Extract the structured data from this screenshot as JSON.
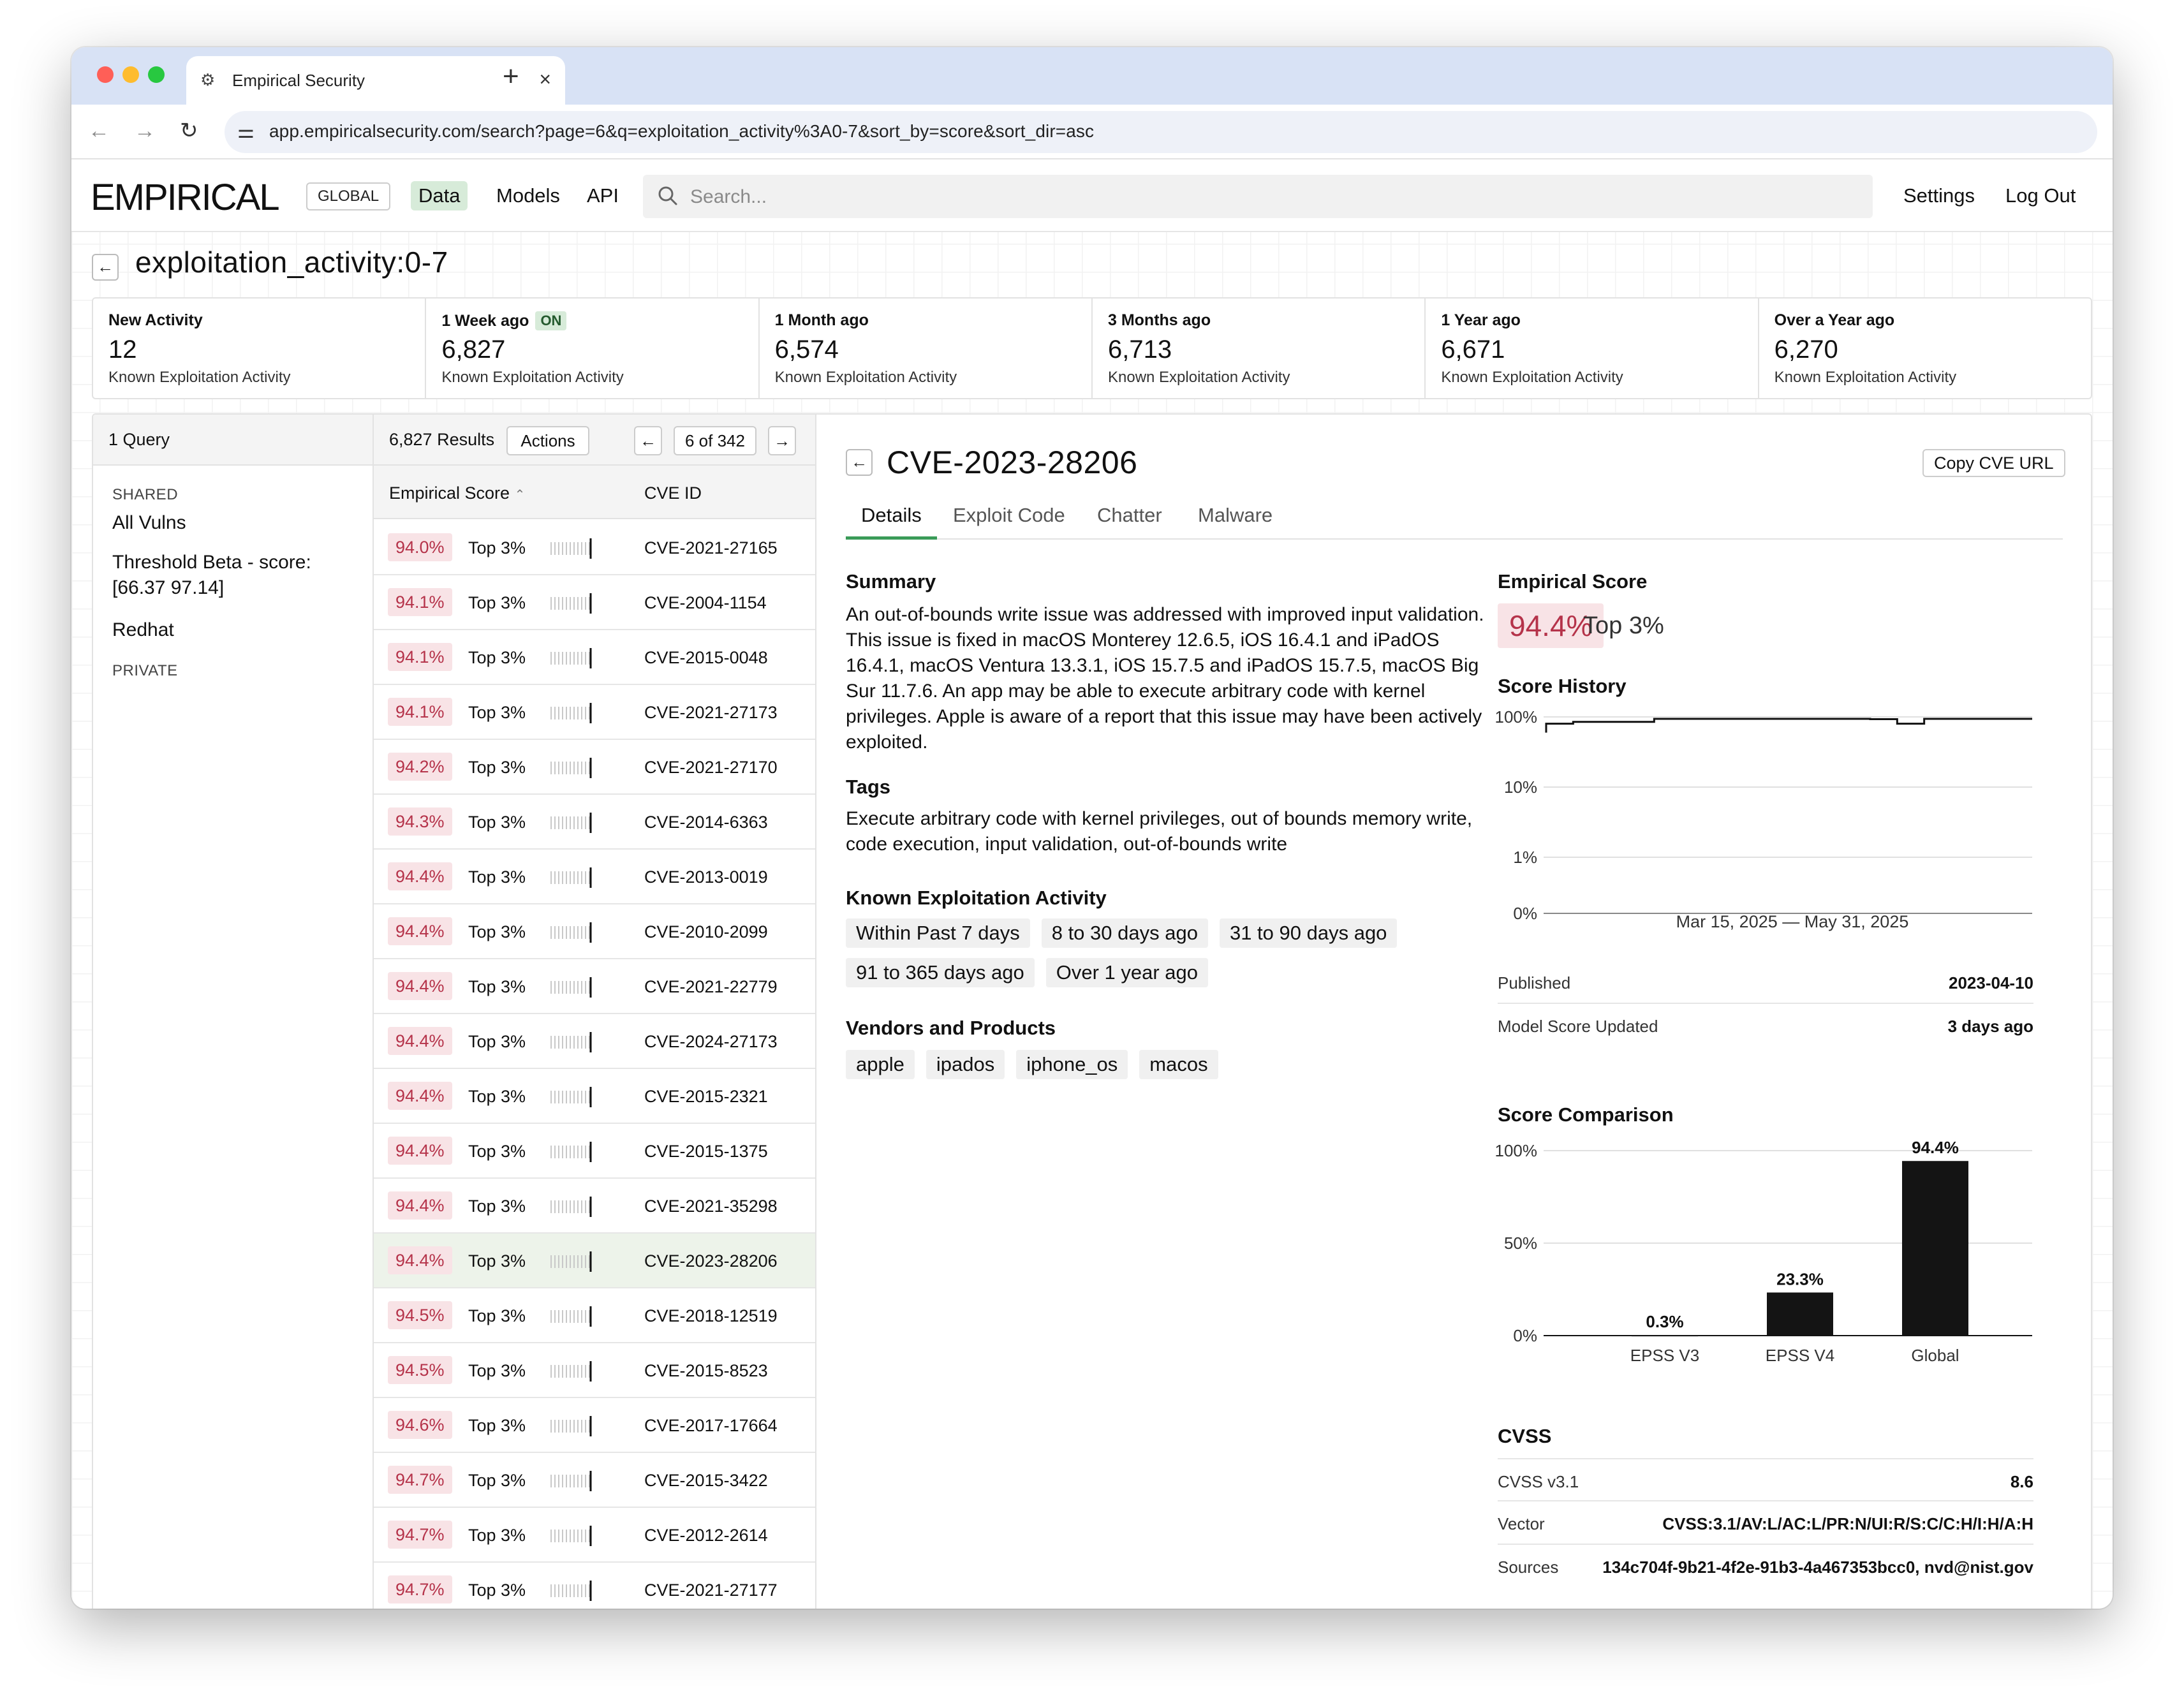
{
  "browser": {
    "tab_title": "Empirical Security",
    "url": "app.empiricalsecurity.com/search?page=6&q=exploitation_activity%3A0-7&sort_by=score&sort_dir=asc"
  },
  "nav": {
    "logo": "EMPIRICAL",
    "scope": "GLOBAL",
    "links": [
      "Data",
      "Models",
      "API"
    ],
    "active_link": "Data",
    "search_placeholder": "Search...",
    "settings": "Settings",
    "logout": "Log Out"
  },
  "page_title": "exploitation_activity:0-7",
  "stats": [
    {
      "label": "New Activity",
      "value": "12",
      "sub": "Known Exploitation Activity"
    },
    {
      "label": "1 Week ago",
      "badge": "ON",
      "value": "6,827",
      "sub": "Known Exploitation Activity"
    },
    {
      "label": "1 Month ago",
      "value": "6,574",
      "sub": "Known Exploitation Activity"
    },
    {
      "label": "3 Months ago",
      "value": "6,713",
      "sub": "Known Exploitation Activity"
    },
    {
      "label": "1 Year ago",
      "value": "6,671",
      "sub": "Known Exploitation Activity"
    },
    {
      "label": "Over a Year ago",
      "value": "6,270",
      "sub": "Known Exploitation Activity"
    }
  ],
  "queries": {
    "header": "1 Query",
    "shared_label": "SHARED",
    "shared": [
      "All Vulns",
      "Threshold Beta - score: [66.37 97.14]",
      "Redhat"
    ],
    "private_label": "PRIVATE"
  },
  "results": {
    "count": "6,827 Results",
    "actions": "Actions",
    "page": "6 of 342",
    "col_score": "Empirical Score",
    "col_cve": "CVE ID",
    "rows": [
      {
        "score": "94.0%",
        "rank": "Top 3%",
        "cve": "CVE-2021-27165"
      },
      {
        "score": "94.1%",
        "rank": "Top 3%",
        "cve": "CVE-2004-1154"
      },
      {
        "score": "94.1%",
        "rank": "Top 3%",
        "cve": "CVE-2015-0048"
      },
      {
        "score": "94.1%",
        "rank": "Top 3%",
        "cve": "CVE-2021-27173"
      },
      {
        "score": "94.2%",
        "rank": "Top 3%",
        "cve": "CVE-2021-27170"
      },
      {
        "score": "94.3%",
        "rank": "Top 3%",
        "cve": "CVE-2014-6363"
      },
      {
        "score": "94.4%",
        "rank": "Top 3%",
        "cve": "CVE-2013-0019"
      },
      {
        "score": "94.4%",
        "rank": "Top 3%",
        "cve": "CVE-2010-2099"
      },
      {
        "score": "94.4%",
        "rank": "Top 3%",
        "cve": "CVE-2021-22779"
      },
      {
        "score": "94.4%",
        "rank": "Top 3%",
        "cve": "CVE-2024-27173"
      },
      {
        "score": "94.4%",
        "rank": "Top 3%",
        "cve": "CVE-2015-2321"
      },
      {
        "score": "94.4%",
        "rank": "Top 3%",
        "cve": "CVE-2015-1375"
      },
      {
        "score": "94.4%",
        "rank": "Top 3%",
        "cve": "CVE-2021-35298"
      },
      {
        "score": "94.4%",
        "rank": "Top 3%",
        "cve": "CVE-2023-28206",
        "selected": true
      },
      {
        "score": "94.5%",
        "rank": "Top 3%",
        "cve": "CVE-2018-12519"
      },
      {
        "score": "94.5%",
        "rank": "Top 3%",
        "cve": "CVE-2015-8523"
      },
      {
        "score": "94.6%",
        "rank": "Top 3%",
        "cve": "CVE-2017-17664"
      },
      {
        "score": "94.7%",
        "rank": "Top 3%",
        "cve": "CVE-2015-3422"
      },
      {
        "score": "94.7%",
        "rank": "Top 3%",
        "cve": "CVE-2012-2614"
      },
      {
        "score": "94.7%",
        "rank": "Top 3%",
        "cve": "CVE-2021-27177"
      }
    ]
  },
  "detail": {
    "cve_id": "CVE-2023-28206",
    "copy_url": "Copy CVE URL",
    "tabs": [
      "Details",
      "Exploit Code",
      "Chatter",
      "Malware"
    ],
    "active_tab": "Details",
    "summary_label": "Summary",
    "summary": "An out-of-bounds write issue was addressed with improved input validation. This issue is fixed in macOS Monterey 12.6.5, iOS 16.4.1 and iPadOS 16.4.1, macOS Ventura 13.3.1, iOS 15.7.5 and iPadOS 15.7.5, macOS Big Sur 11.7.6. An app may be able to execute arbitrary code with kernel privileges. Apple is aware of a report that this issue may have been actively exploited.",
    "tags_label": "Tags",
    "tags": "Execute arbitrary code with kernel privileges, out of bounds memory write, code execution, input validation, out-of-bounds write",
    "exploitation_label": "Known Exploitation Activity",
    "exploitation": [
      "Within Past 7 days",
      "8 to 30 days ago",
      "31 to 90 days ago",
      "91 to 365 days ago",
      "Over 1 year ago"
    ],
    "vendors_label": "Vendors and Products",
    "vendors": [
      "apple",
      "ipados",
      "iphone_os",
      "macos"
    ],
    "empirical_score_label": "Empirical Score",
    "empirical_score": "94.4%",
    "empirical_rank": "Top 3%",
    "score_history_label": "Score History",
    "published_label": "Published",
    "published": "2023-04-10",
    "model_updated_label": "Model Score Updated",
    "model_updated": "3 days ago",
    "score_comparison_label": "Score Comparison",
    "cvss_label": "CVSS",
    "cvss_version_label": "CVSS v3.1",
    "cvss_score": "8.6",
    "vector_label": "Vector",
    "vector": "CVSS:3.1/AV:L/AC:L/PR:N/UI:R/S:C/C:H/I:H/A:H",
    "sources_label": "Sources",
    "sources": "134c704f-9b21-4f2e-91b3-4a467353bcc0, nvd@nist.gov"
  },
  "chart_data": [
    {
      "type": "line",
      "title": "Score History",
      "xlabel": "Mar 15, 2025 — May 31, 2025",
      "y_ticks": [
        "100%",
        "10%",
        "1%",
        "0%"
      ],
      "y_scale": "log",
      "series": [
        {
          "values": [
            80,
            85,
            85,
            85,
            94,
            94,
            94,
            94,
            94,
            94,
            94,
            94,
            93,
            80,
            94,
            94,
            94,
            94,
            94
          ]
        }
      ]
    },
    {
      "type": "bar",
      "title": "Score Comparison",
      "categories": [
        "EPSS V3",
        "EPSS V4",
        "Global"
      ],
      "values": [
        0.3,
        23.3,
        94.4
      ],
      "data_labels": [
        "0.3%",
        "23.3%",
        "94.4%"
      ],
      "y_ticks": [
        "100%",
        "50%",
        "0%"
      ],
      "ylim": [
        0,
        100
      ]
    }
  ],
  "icons": [
    "back-arrow-icon",
    "forward-arrow-icon",
    "reload-icon",
    "site-settings-icon",
    "search-icon",
    "close-icon",
    "plus-icon",
    "sort-up-icon"
  ]
}
